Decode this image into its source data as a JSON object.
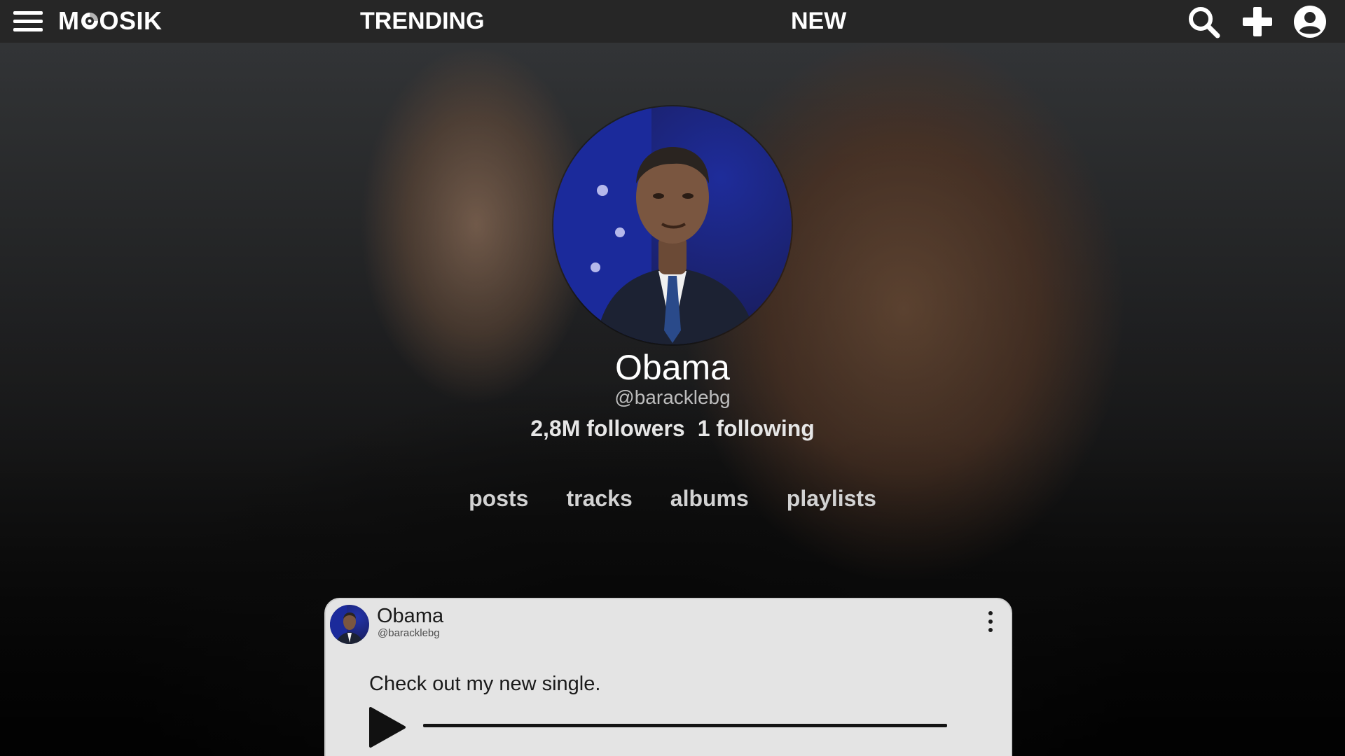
{
  "nav": {
    "logo": {
      "before": "M",
      "after": "OSIK"
    },
    "links": [
      "TRENDING",
      "NEW"
    ],
    "icons": [
      "menu-icon",
      "search-icon",
      "add-icon",
      "account-icon"
    ]
  },
  "profile": {
    "name": "Obama",
    "handle": "@baracklebg",
    "followers": "2,8M followers",
    "following": "1 following",
    "tabs": [
      "posts",
      "tracks",
      "albums",
      "playlists"
    ]
  },
  "post": {
    "author": "Obama",
    "handle": "@baracklebg",
    "text": "Check out my new single.",
    "progress": 0
  },
  "colors": {
    "topbar": "#262626",
    "card": "#e4e4e4",
    "avatar_bg": "#1a2068"
  }
}
